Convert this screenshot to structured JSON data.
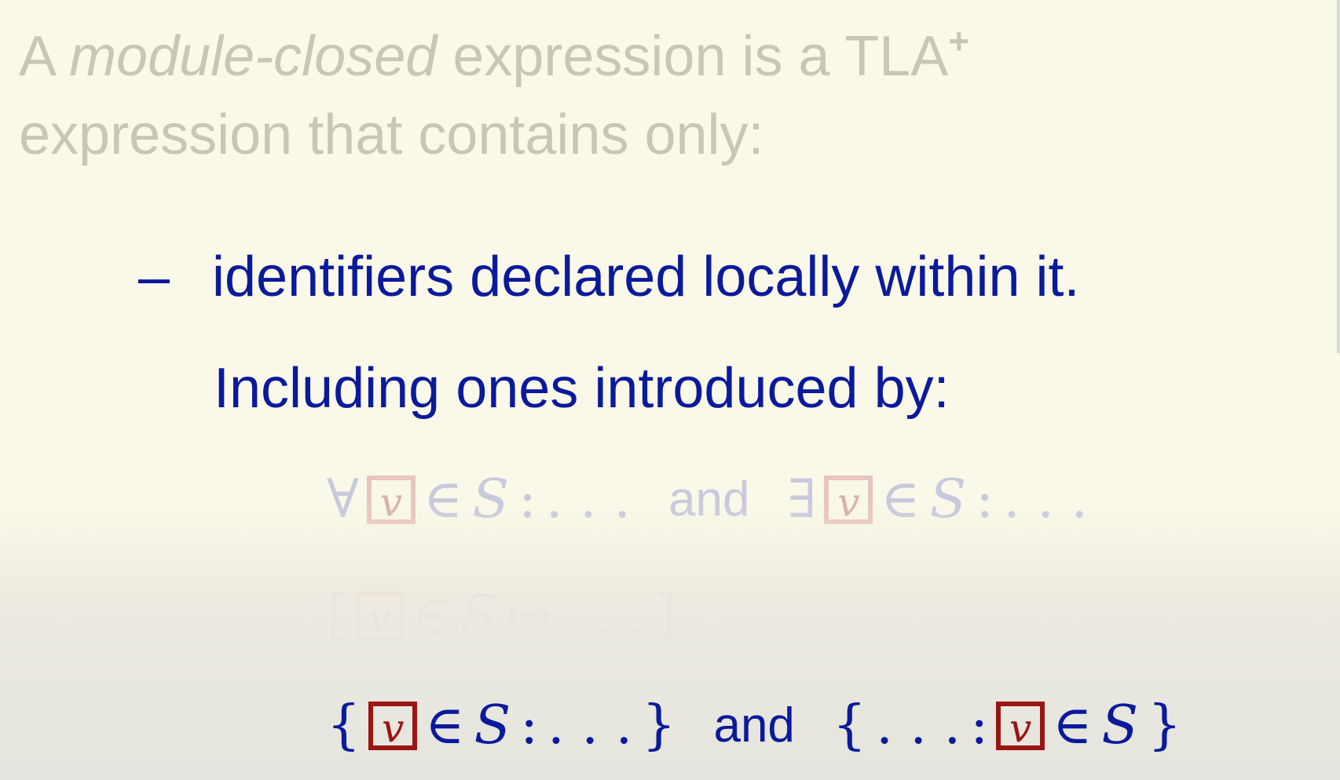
{
  "heading": {
    "prefix": "A ",
    "italic": "module-closed",
    "middle": " expression is a TLA",
    "plus": "+",
    "line2": "expression that contains only:"
  },
  "bullet": {
    "dash": "–",
    "text": "identifiers declared locally within it."
  },
  "including": "Including ones introduced by:",
  "math": {
    "forall": "∀",
    "exists": "∃",
    "var": "v",
    "in": "∈",
    "set": "S",
    "colon": ":",
    "dots": ". . .",
    "and": "and",
    "lbracket": "[",
    "rbracket": "]",
    "mapsto": "↦",
    "lbrace": "{",
    "rbrace": "}"
  },
  "colors": {
    "background": "#faf8e8",
    "heading": "#c9c6b5",
    "body": "#0a1a9c",
    "box": "#9b1414"
  }
}
